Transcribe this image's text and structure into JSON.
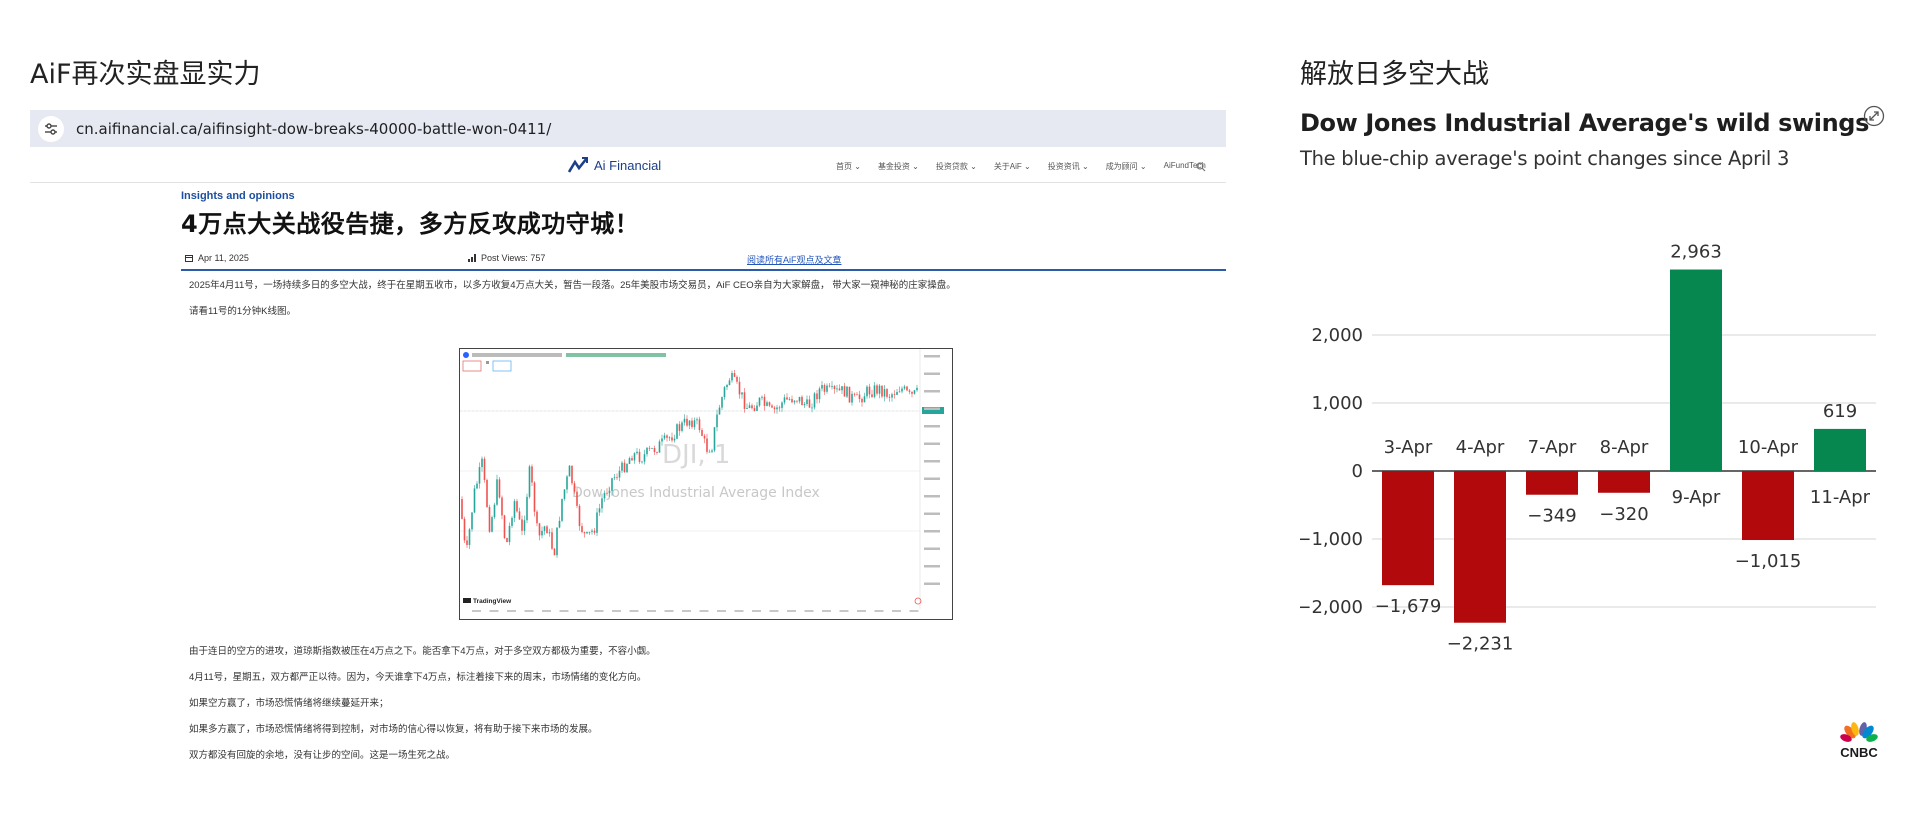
{
  "left_panel": {
    "title": "AiF再次实盘显实力"
  },
  "right_panel": {
    "title": "解放日多空大战"
  },
  "browser": {
    "url": "cn.aifinancial.ca/aifinsight-dow-breaks-40000-battle-won-0411/"
  },
  "site": {
    "brand": "Ai Financial",
    "nav": [
      "首页 ⌄",
      "基金投资 ⌄",
      "投资贷款 ⌄",
      "关于AiF ⌄",
      "投资资讯 ⌄",
      "成为顾问 ⌄",
      "AiFundTech"
    ]
  },
  "article": {
    "category": "Insights and opinions",
    "headline": "4万点大关战役告捷，多方反攻成功守城！",
    "date": "Apr 11, 2025",
    "views": "Post Views: 757",
    "link": "阅读所有AiF观点及文章",
    "intro": "2025年4月11号，一场持续多日的多空大战，终于在星期五收市，以多方收复4万点大关，暂告一段落。25年美股市场交易员，AiF CEO亲自为大家解盘， 带大家一窥神秘的庄家操盘。",
    "see_chart": "请看11号的1分钟K线图。",
    "paragraphs": [
      "由于连日的空方的进攻，道琼斯指数被压在4万点之下。能否拿下4万点，对于多空双方都极为重要，不容小觑。",
      "4月11号，星期五，双方都严正以待。因为，今天谁拿下4万点，标注着接下来的周末，市场情绪的变化方向。",
      "如果空方赢了，市场恐慌情绪将继续蔓延开来；",
      "如果多方赢了，市场恐慌情绪将得到控制，对市场的信心得以恢复，将有助于接下来市场的发展。",
      "双方都没有回旋的余地，没有让步的空间。这是一场生死之战。"
    ]
  },
  "embedded_chart": {
    "watermark_symbol": "DJI, 1",
    "watermark_name": "Dow Jones Industrial Average Index",
    "source": "TradingView"
  },
  "chart_data": {
    "type": "bar",
    "title": "Dow Jones Industrial Average's wild swings",
    "subtitle": "The blue-chip average's point changes since April 3",
    "categories": [
      "3-Apr",
      "4-Apr",
      "7-Apr",
      "8-Apr",
      "9-Apr",
      "10-Apr",
      "11-Apr"
    ],
    "values": [
      -1679,
      -2231,
      -349,
      -320,
      2963,
      -1015,
      619
    ],
    "value_labels": [
      "−1,679",
      "−2,231",
      "−349",
      "−320",
      "2,963",
      "−1,015",
      "619"
    ],
    "yticks": [
      2000,
      1000,
      0,
      -1000,
      -2000
    ],
    "ytick_labels": [
      "2,000",
      "1,000",
      "0",
      "−1,000",
      "−2,000"
    ],
    "ylim": [
      -2400,
      3300
    ],
    "grid": true,
    "colors": {
      "positive": "#078750",
      "negative": "#b20a0c"
    },
    "source": "CNBC"
  }
}
